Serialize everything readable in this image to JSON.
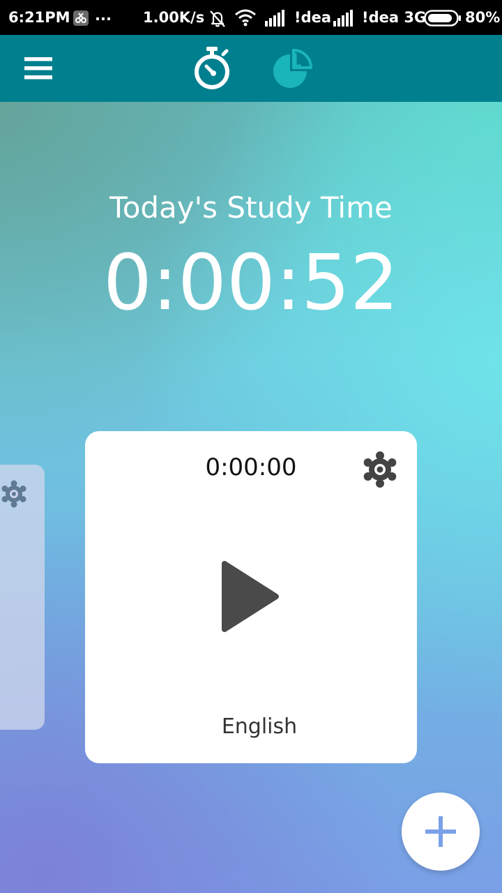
{
  "status_bar": {
    "time": "6:21PM",
    "more": "...",
    "speed": "1.00K/s",
    "carrier1": "!dea",
    "carrier2": "!dea 3G",
    "battery": "80%"
  },
  "app_bar": {
    "menu_icon": "hamburger-menu-icon",
    "timer_tab_icon": "stopwatch-icon",
    "stats_tab_icon": "pie-chart-icon",
    "color": "#007f8e"
  },
  "summary": {
    "title": "Today's Study Time",
    "total_time": "0:00:52"
  },
  "timer_card": {
    "time": "0:00:00",
    "label": "English",
    "settings_icon": "gear-icon",
    "play_icon": "play-icon"
  },
  "fab": {
    "icon": "plus-icon",
    "icon_color": "#7ba1e8"
  }
}
